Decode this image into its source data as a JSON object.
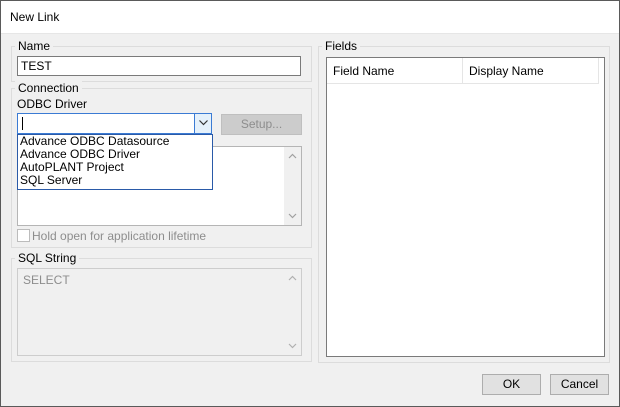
{
  "window": {
    "title": "New Link"
  },
  "name_group": {
    "legend": "Name",
    "value": "TEST"
  },
  "connection_group": {
    "legend": "Connection",
    "odbc_label": "ODBC Driver",
    "odbc_value": "",
    "setup_label": "Setup...",
    "dropdown_options": [
      "Advance ODBC Datasource",
      "Advance ODBC Driver",
      "AutoPLANT Project",
      "SQL Server"
    ],
    "hold_open_label": "Hold open for application lifetime",
    "hold_open_checked": false
  },
  "sql_group": {
    "legend": "SQL String",
    "value": "SELECT"
  },
  "fields_group": {
    "legend": "Fields",
    "columns": [
      "Field Name",
      "Display Name"
    ]
  },
  "buttons": {
    "ok": "OK",
    "cancel": "Cancel"
  }
}
